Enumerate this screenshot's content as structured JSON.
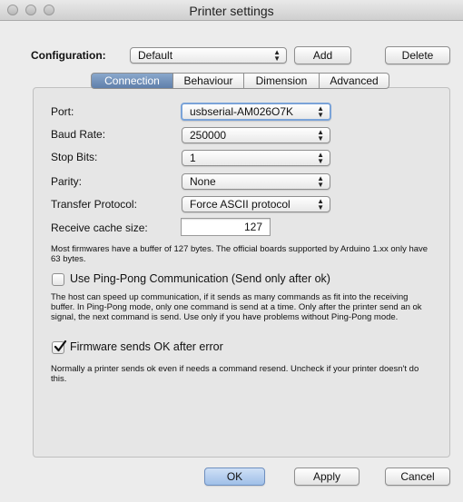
{
  "window": {
    "title": "Printer settings"
  },
  "config": {
    "label": "Configuration:",
    "value": "Default",
    "add": "Add",
    "delete": "Delete"
  },
  "tabs": [
    "Connection",
    "Behaviour",
    "Dimension",
    "Advanced"
  ],
  "fields": {
    "port_label": "Port:",
    "port_value": "usbserial-AM026O7K",
    "baud_label": "Baud Rate:",
    "baud_value": "250000",
    "stop_label": "Stop Bits:",
    "stop_value": "1",
    "parity_label": "Parity:",
    "parity_value": "None",
    "protocol_label": "Transfer Protocol:",
    "protocol_value": "Force ASCII protocol",
    "cache_label": "Receive cache size:",
    "cache_value": "127"
  },
  "notes": {
    "cache_note": "Most firmwares have a buffer of 127 bytes. The official boards supported by Arduino 1.xx only have 63 bytes.",
    "pingpong_label": "Use Ping-Pong Communication (Send only after ok)",
    "pingpong_checked": false,
    "pingpong_note": "The host can speed up communication, if it sends as many commands as fit into the receiving buffer. In Ping-Pong mode, only one command is send at a time. Only after the printer send an ok signal, the next command is send. Use only if you have problems without Ping-Pong mode.",
    "firmware_label": "Firmware sends OK after error",
    "firmware_checked": true,
    "firmware_note": "Normally a printer sends ok even if needs a command resend. Uncheck if your printer doesn't do this."
  },
  "buttons": {
    "ok": "OK",
    "apply": "Apply",
    "cancel": "Cancel"
  }
}
